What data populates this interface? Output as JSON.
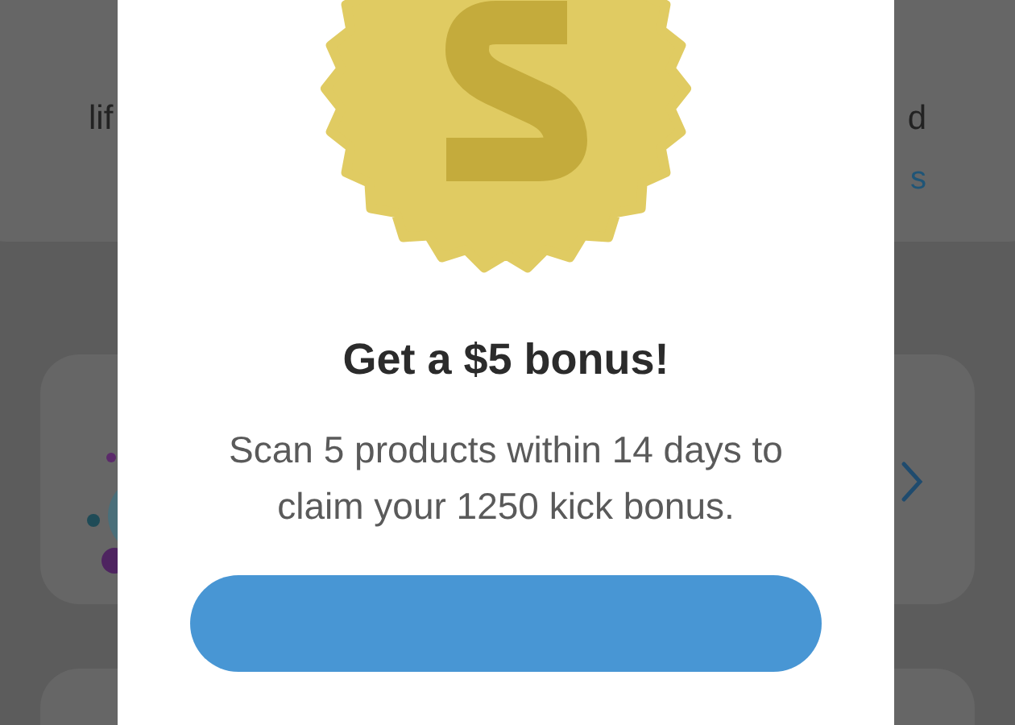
{
  "background": {
    "top_card": {
      "left_fragment": "lif",
      "right_fragment": "d",
      "link_fragment": "s"
    }
  },
  "modal": {
    "title": "Get a $5 bonus!",
    "message": "Scan 5 products within 14 days to claim your 1250 kick bonus."
  }
}
